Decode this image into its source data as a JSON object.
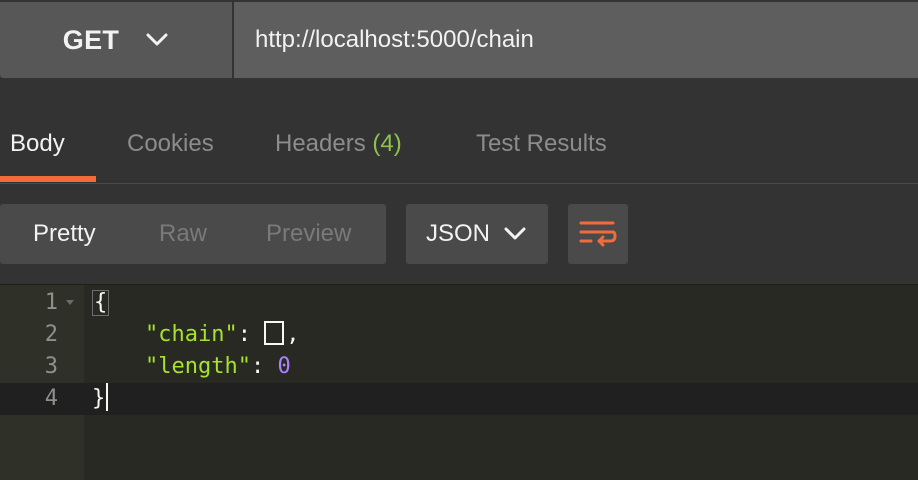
{
  "request": {
    "method": "GET",
    "url": "http://localhost:5000/chain"
  },
  "response_tabs": [
    {
      "label": "Body",
      "active": true
    },
    {
      "label": "Cookies",
      "active": false
    },
    {
      "label": "Headers",
      "count": "(4)",
      "active": false
    },
    {
      "label": "Test Results",
      "active": false
    }
  ],
  "view_modes": [
    {
      "label": "Pretty",
      "active": true
    },
    {
      "label": "Raw",
      "active": false
    },
    {
      "label": "Preview",
      "active": false
    }
  ],
  "format": {
    "selected": "JSON"
  },
  "icons": {
    "method_dropdown": "chevron-down-icon",
    "format_dropdown": "chevron-down-icon",
    "wrap": "wrap-lines-icon",
    "fold": "fold-caret-icon"
  },
  "code": {
    "line_numbers": [
      "1",
      "2",
      "3",
      "4"
    ],
    "open_brace": "{",
    "close_brace": "}",
    "key_chain": "\"chain\"",
    "key_length": "\"length\"",
    "colon": ":",
    "comma": ",",
    "value_length": "0"
  },
  "colors": {
    "accent": "#f26b3a",
    "count": "#8cc152",
    "json_key": "#a6e22e",
    "json_number": "#ae81ff",
    "editor_bg": "#282923"
  }
}
